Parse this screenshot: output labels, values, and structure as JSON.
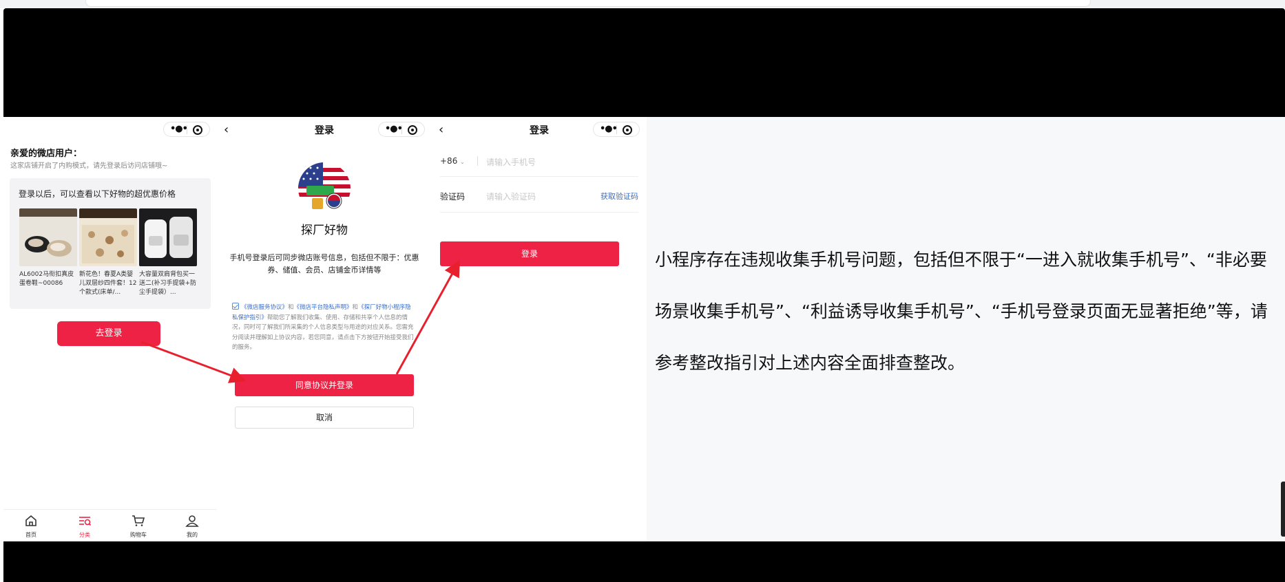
{
  "panel_home": {
    "greeting": "亲爱的微店用户：",
    "notice": "这家店铺开启了内购模式，请先登录后访问店铺哦~",
    "card_title": "登录以后，可以查看以下好物的超优惠价格",
    "products": [
      {
        "name": "AL6002马衔扣真皮蛋卷鞋~00086"
      },
      {
        "name": "新花色！春夏A类婴儿双层纱四件套！12个款式(床单/..."
      },
      {
        "name": "大容量双肩背包买一送二(补习手提袋+防尘手提袋）..."
      }
    ],
    "login_button": "去登录",
    "tabs": [
      {
        "label": "首页",
        "icon": "home-icon"
      },
      {
        "label": "分类",
        "icon": "category-icon",
        "active": true
      },
      {
        "label": "购物车",
        "icon": "cart-icon"
      },
      {
        "label": "我的",
        "icon": "profile-icon"
      }
    ]
  },
  "panel_login": {
    "title": "登录",
    "shop_name": "探厂好物",
    "info": "手机号登录后可同步微店账号信息，包括但不限于：优惠券、储值、会员、店铺金币详情等",
    "agreement": {
      "link1": "《微店服务协议》",
      "and1": "和",
      "link2": "《微店平台隐私声明》",
      "and2": "和",
      "link3": "《探厂好物小程序隐私保护指引》",
      "body": "帮助您了解我们收集、使用、存储和共享个人信息的情况，同时可了解我们所采集的个人信息类型与用途的对应关系。您需充分阅读并理解如上协议内容，若您同意，请点击下方按钮开始接受我们的服务。"
    },
    "agree_button": "同意协议并登录",
    "cancel_button": "取消"
  },
  "panel_phone": {
    "title": "登录",
    "country_code": "+86",
    "phone_placeholder": "请输入手机号",
    "code_label": "验证码",
    "code_placeholder": "请输入验证码",
    "get_code": "获取验证码",
    "login_button": "登录"
  },
  "description": "小程序存在违规收集手机号问题，包括但不限于“一进入就收集手机号”、“非必要场景收集手机号”、“利益诱导收集手机号”、“手机号登录页面无显著拒绝”等，请参考整改指引对上述内容全面排查整改。",
  "colors": {
    "accent": "#ee2244",
    "link": "#3b6ec8",
    "arrow": "#e8202e",
    "frame": "#000000",
    "desc_bg": "#f7f8fa"
  }
}
